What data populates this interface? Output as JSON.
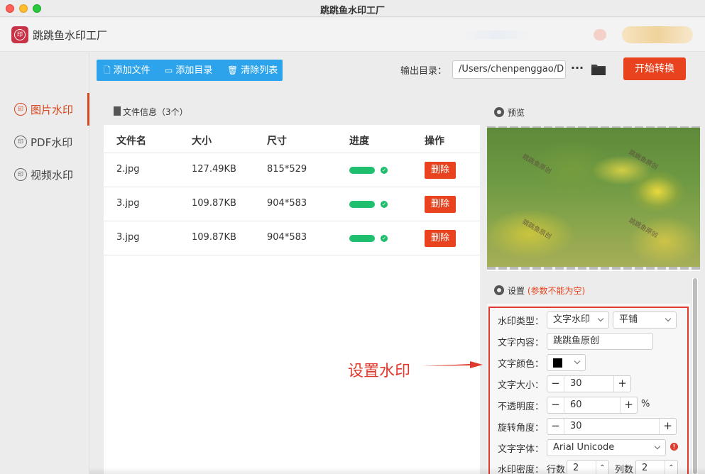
{
  "window": {
    "title": "跳跳鱼水印工厂"
  },
  "header": {
    "app_name": "跳跳鱼水印工厂"
  },
  "sidebar": {
    "items": [
      {
        "label": "图片水印",
        "active": true
      },
      {
        "label": "PDF水印",
        "active": false
      },
      {
        "label": "视频水印",
        "active": false
      }
    ]
  },
  "toolbar": {
    "add_file": "添加文件",
    "add_dir": "添加目录",
    "clear_list": "清除列表",
    "output_label": "输出目录：",
    "output_path": "/Users/chenpenggao/D",
    "more": "···",
    "start": "开始转换"
  },
  "files": {
    "title": "文件信息（3个）",
    "columns": [
      "文件名",
      "大小",
      "尺寸",
      "进度",
      "操作"
    ],
    "rows": [
      {
        "name": "2.jpg",
        "size": "127.49KB",
        "dims": "815*529",
        "progress": 1.0,
        "action": "删除"
      },
      {
        "name": "3.jpg",
        "size": "109.87KB",
        "dims": "904*583",
        "progress": 1.0,
        "action": "删除"
      },
      {
        "name": "3.jpg",
        "size": "109.87KB",
        "dims": "904*583",
        "progress": 1.0,
        "action": "删除"
      }
    ]
  },
  "preview": {
    "title": "预览",
    "watermarks": [
      "跳跳鱼原创",
      "跳跳鱼原创",
      "跳跳鱼原创",
      "跳跳鱼原创"
    ]
  },
  "settings": {
    "title": "设置",
    "note": "(参数不能为空)",
    "type_label": "水印类型：",
    "type_value": "文字水印",
    "layout_value": "平铺",
    "text_label": "文字内容：",
    "text_value": "跳跳鱼原创",
    "color_label": "文字颜色：",
    "color_value": "#000000",
    "size_label": "文字大小：",
    "size_value": "30",
    "opacity_label": "不透明度：",
    "opacity_value": "60",
    "opacity_unit": "%",
    "rotation_label": "旋转角度：",
    "rotation_value": "30",
    "font_label": "文字字体：",
    "font_value": "Arial Unicode",
    "density_label": "水印密度：",
    "rows_label": "行数",
    "rows_value": "2",
    "cols_label": "列数",
    "cols_value": "2",
    "alert_icon": "!"
  },
  "annotation": {
    "text": "设置水印"
  },
  "colors": {
    "accent": "#e8431e",
    "toolbar": "#2ca3ea",
    "progress": "#1fbf6f",
    "annotation": "#e03a2e"
  }
}
